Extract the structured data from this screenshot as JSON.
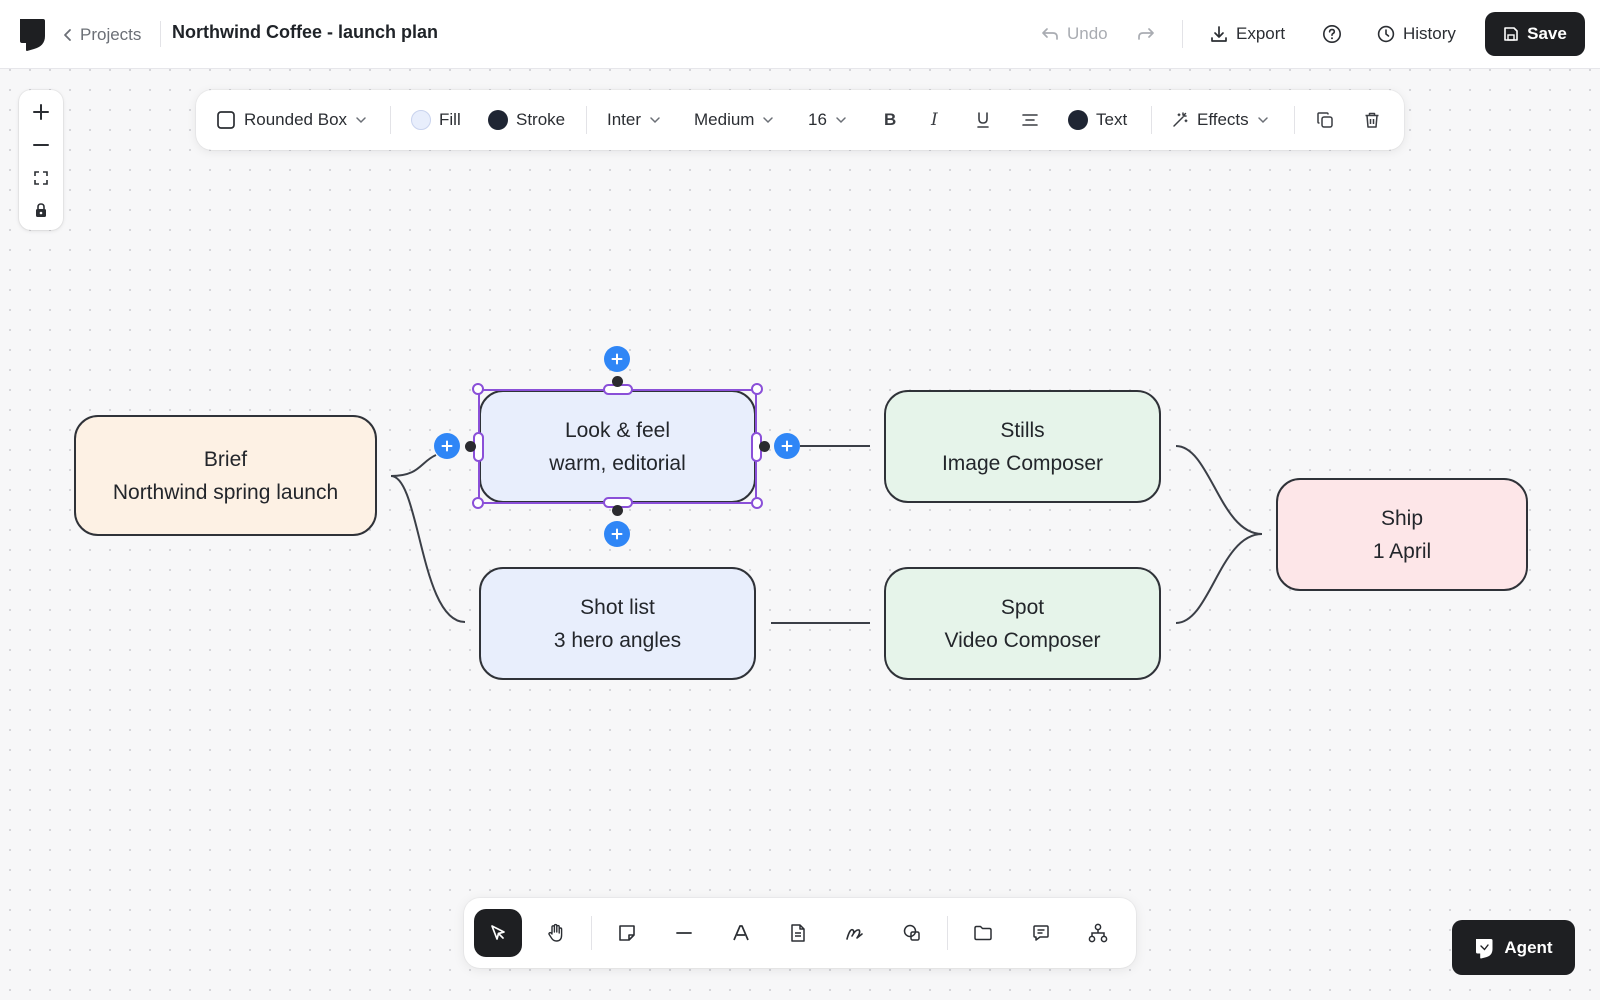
{
  "header": {
    "back_label": "Projects",
    "document_title": "Northwind Coffee - launch plan",
    "undo_label": "Undo",
    "export_label": "Export",
    "history_label": "History",
    "save_label": "Save"
  },
  "format_toolbar": {
    "shape_label": "Rounded Box",
    "fill_label": "Fill",
    "fill_color": "#e8eefc",
    "stroke_label": "Stroke",
    "stroke_color": "#1f2533",
    "font_family": "Inter",
    "font_weight": "Medium",
    "font_size": "16",
    "bold_glyph": "B",
    "italic_glyph": "I",
    "text_color_label": "Text",
    "text_color": "#1f2533",
    "effects_label": "Effects"
  },
  "nodes": {
    "brief": {
      "line1": "Brief",
      "line2": "Northwind spring launch",
      "fill": "#fdf1e4"
    },
    "look": {
      "line1": "Look & feel",
      "line2": "warm, editorial",
      "fill": "#e8eefc",
      "selected": true
    },
    "shot": {
      "line1": "Shot list",
      "line2": "3 hero angles",
      "fill": "#e8eefc"
    },
    "stills": {
      "line1": "Stills",
      "line2": "Image Composer",
      "fill": "#e6f4ea"
    },
    "spot": {
      "line1": "Spot",
      "line2": "Video Composer",
      "fill": "#e6f4ea"
    },
    "ship": {
      "line1": "Ship",
      "line2": "1 April",
      "fill": "#fde6e8"
    }
  },
  "dock": {
    "tools": [
      "select-icon",
      "hand-icon",
      "sticky-note-icon",
      "line-icon",
      "text-icon",
      "document-icon",
      "pen-icon",
      "shapes-icon",
      "folder-icon",
      "comment-icon",
      "hierarchy-icon"
    ],
    "active_tool": "select-icon"
  },
  "agent_label": "Agent",
  "colors": {
    "accent_blue": "#2f86f6",
    "selection_purple": "#8a4fd8",
    "dark_button": "#1e1f22"
  }
}
